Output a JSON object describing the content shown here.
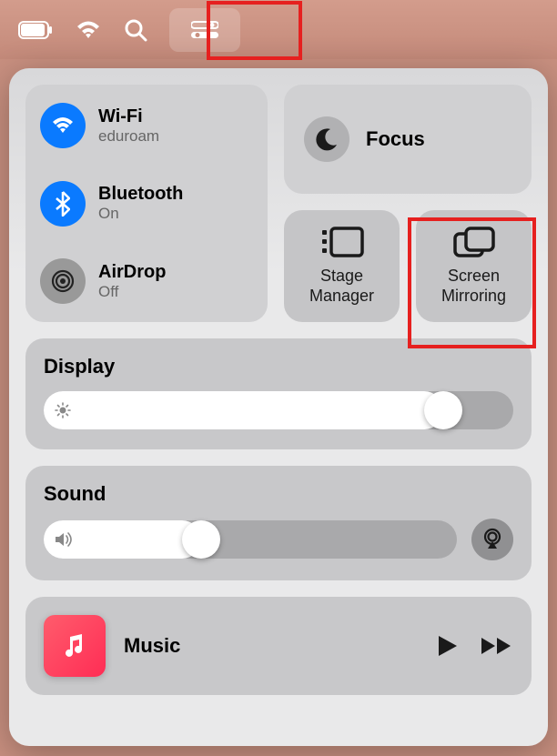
{
  "menubar": {
    "items": [
      "battery",
      "wifi",
      "search",
      "control-center"
    ]
  },
  "connectivity": {
    "wifi": {
      "title": "Wi-Fi",
      "status": "eduroam",
      "on": true
    },
    "bluetooth": {
      "title": "Bluetooth",
      "status": "On",
      "on": true
    },
    "airdrop": {
      "title": "AirDrop",
      "status": "Off",
      "on": false
    }
  },
  "focus": {
    "label": "Focus"
  },
  "tiles": {
    "stage_manager": {
      "label": "Stage\nManager"
    },
    "screen_mirroring": {
      "label": "Screen\nMirroring"
    }
  },
  "display": {
    "label": "Display",
    "value": 85
  },
  "sound": {
    "label": "Sound",
    "value": 38
  },
  "music": {
    "title": "Music"
  }
}
